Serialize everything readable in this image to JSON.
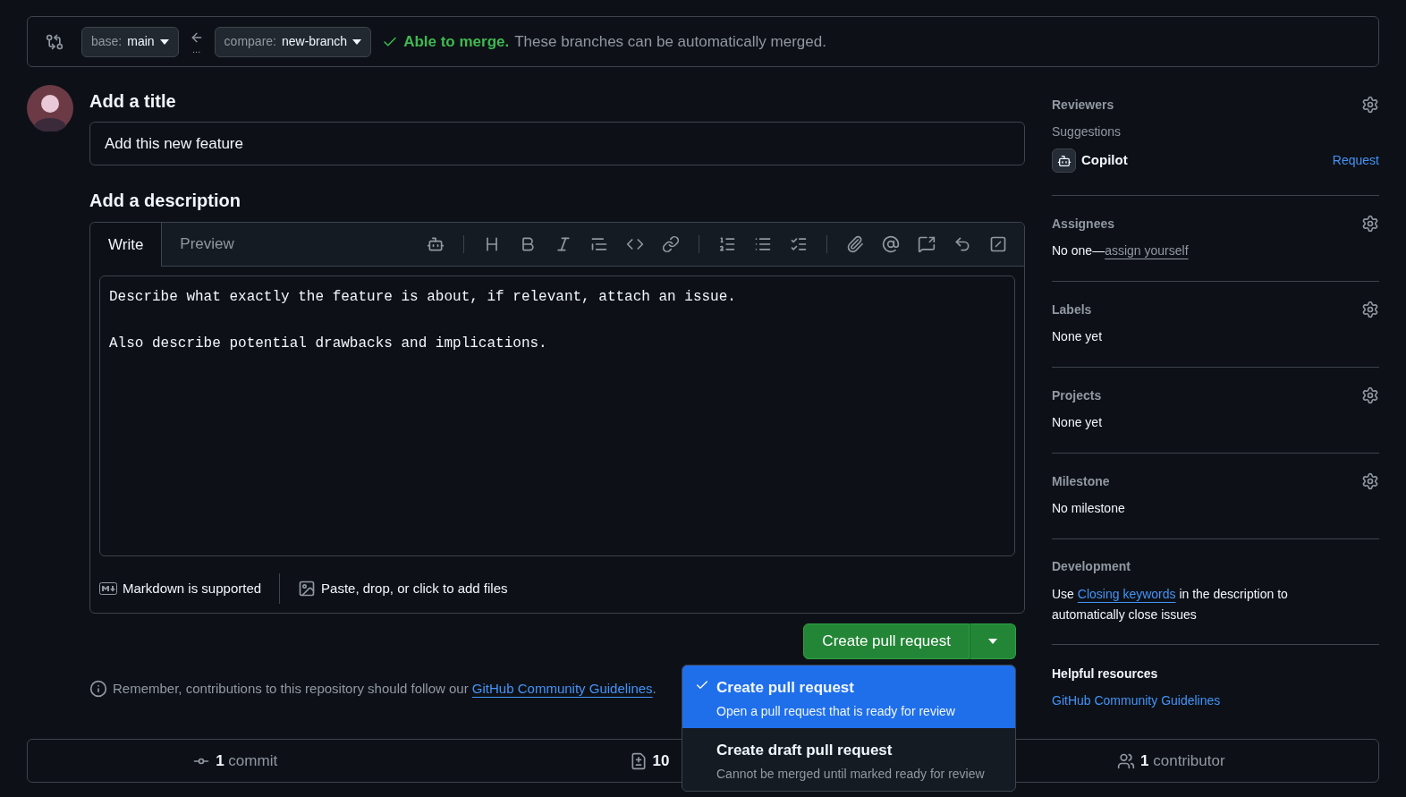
{
  "compare_bar": {
    "base": {
      "prefix": "base: ",
      "branch": "main"
    },
    "compare": {
      "prefix": "compare: ",
      "branch": "new-branch"
    },
    "dots": "...",
    "status": "Able to merge.",
    "message": "These branches can be automatically merged."
  },
  "form": {
    "title_label": "Add a title",
    "title_value": "Add this new feature",
    "description_label": "Add a description",
    "tabs": [
      {
        "label": "Write",
        "selected": true
      },
      {
        "label": "Preview",
        "selected": false
      }
    ],
    "description_value": "Describe what exactly the feature is about, if relevant, attach an issue.\n\nAlso describe potential drawbacks and implications.",
    "markdown_note": "Markdown is supported",
    "attach_note": "Paste, drop, or click to add files",
    "submit": "Create pull request",
    "menu": [
      {
        "title": "Create pull request",
        "description": "Open a pull request that is ready for review",
        "selected": true
      },
      {
        "title": "Create draft pull request",
        "description": "Cannot be merged until marked ready for review",
        "selected": false
      }
    ],
    "notice_text": "Remember, contributions to this repository should follow our ",
    "notice_link": "GitHub Community Guidelines",
    "notice_end": "."
  },
  "sidebar": {
    "sections": [
      {
        "kind": "reviewers",
        "heading": "Reviewers",
        "settings": true,
        "subheading": "Suggestions",
        "name": "Copilot",
        "action": "Request"
      },
      {
        "kind": "assignees",
        "heading": "Assignees",
        "settings": true,
        "text": "No one—",
        "link": "assign yourself"
      },
      {
        "kind": "plain",
        "heading": "Labels",
        "settings": true,
        "text": "None yet"
      },
      {
        "kind": "plain",
        "heading": "Projects",
        "settings": true,
        "text": "None yet"
      },
      {
        "kind": "plain",
        "heading": "Milestone",
        "settings": true,
        "text": "No milestone"
      },
      {
        "kind": "development",
        "heading": "Development",
        "settings": false,
        "text": "Use ",
        "link": "Closing keywords",
        "text_after": " in the description to automatically close issues"
      },
      {
        "kind": "resources",
        "heading": "Helpful resources",
        "settings": false,
        "link": "GitHub Community Guidelines"
      }
    ]
  },
  "stats": [
    {
      "kind": "commits",
      "text": "**1** commit"
    },
    {
      "kind": "files",
      "text": "**10**"
    },
    {
      "kind": "contributors",
      "text": "**1** contributor"
    }
  ]
}
